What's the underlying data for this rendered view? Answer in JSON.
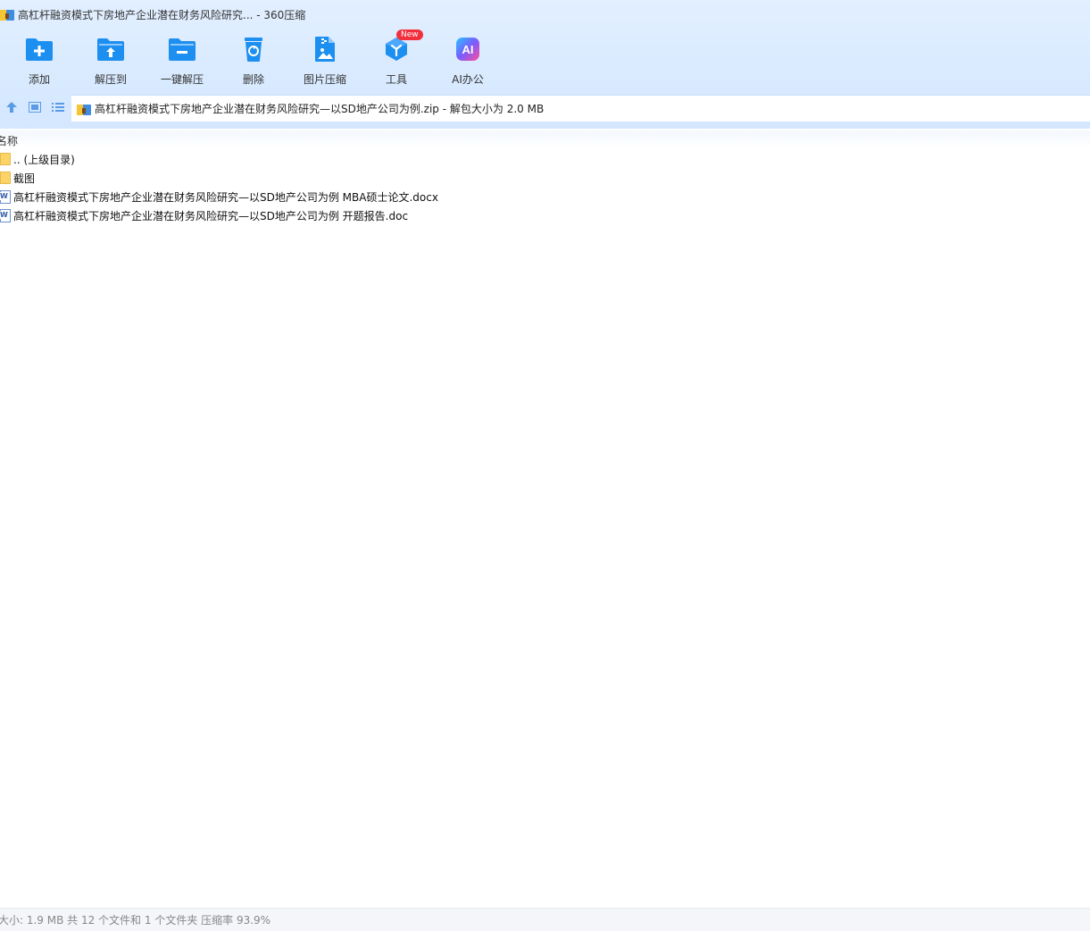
{
  "window": {
    "title": "高杠杆融资模式下房地产企业潜在财务风险研究... - 360压缩"
  },
  "toolbar": {
    "items": [
      {
        "label": "添加",
        "icon": "folder-add-icon"
      },
      {
        "label": "解压到",
        "icon": "folder-extract-icon"
      },
      {
        "label": "一键解压",
        "icon": "folder-minus-icon"
      },
      {
        "label": "删除",
        "icon": "recycle-bin-icon"
      },
      {
        "label": "图片压缩",
        "icon": "image-compress-icon"
      },
      {
        "label": "工具",
        "icon": "toolbox-icon"
      },
      {
        "label": "AI办公",
        "icon": "ai-office-icon"
      }
    ],
    "new_badge": "New",
    "ai_icon_text": "AI"
  },
  "address": {
    "path": "高杠杆融资模式下房地产企业潜在财务风险研究—以SD地产公司为例.zip - 解包大小为 2.0 MB"
  },
  "list": {
    "header_name": "名称",
    "items": [
      {
        "name": ".. (上级目录)",
        "type": "folder"
      },
      {
        "name": "截图",
        "type": "folder"
      },
      {
        "name": "高杠杆融资模式下房地产企业潜在财务风险研究—以SD地产公司为例 MBA硕士论文.docx",
        "type": "word"
      },
      {
        "name": "高杠杆融资模式下房地产企业潜在财务风险研究—以SD地产公司为例 开题报告.doc",
        "type": "word"
      }
    ]
  },
  "status": {
    "text": "大小: 1.9 MB 共 12 个文件和 1 个文件夹 压缩率 93.9%"
  },
  "colors": {
    "accent": "#1d8ff0",
    "toolbar_bg": "#dbeaff",
    "badge": "#f2303d"
  }
}
